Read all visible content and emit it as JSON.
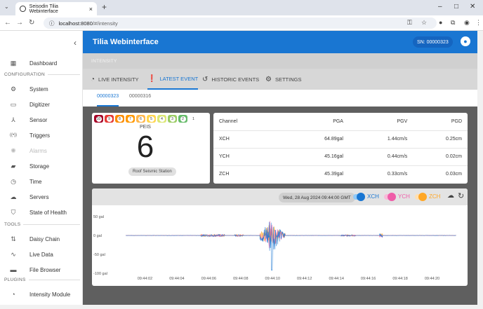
{
  "browser": {
    "tab_title": "Seisodin Tilia Webinterface",
    "url_host": "localhost:8080",
    "url_path": "/#/intensity"
  },
  "sidebar": {
    "items": [
      {
        "label": "Dashboard",
        "icon": "dashboard-icon",
        "glyph": "▦",
        "disabled": false
      },
      {
        "label": "System",
        "icon": "gear-icon",
        "glyph": "⚙",
        "disabled": false
      },
      {
        "label": "Digitizer",
        "icon": "digitizer-icon",
        "glyph": "▭",
        "disabled": false
      },
      {
        "label": "Sensor",
        "icon": "sensor-icon",
        "glyph": "⅄",
        "disabled": false
      },
      {
        "label": "Triggers",
        "icon": "triggers-icon",
        "glyph": "((•))",
        "disabled": false
      },
      {
        "label": "Alarms",
        "icon": "alarm-icon",
        "glyph": "✺",
        "disabled": true
      },
      {
        "label": "Storage",
        "icon": "storage-icon",
        "glyph": "▰",
        "disabled": false
      },
      {
        "label": "Time",
        "icon": "clock-icon",
        "glyph": "◷",
        "disabled": false
      },
      {
        "label": "Servers",
        "icon": "cloud-icon",
        "glyph": "☁",
        "disabled": false
      },
      {
        "label": "State of Health",
        "icon": "shield-icon",
        "glyph": "⛉",
        "disabled": false
      },
      {
        "label": "Daisy Chain",
        "icon": "daisy-chain-icon",
        "glyph": "⇅",
        "disabled": false
      },
      {
        "label": "Live Data",
        "icon": "live-data-icon",
        "glyph": "∿",
        "disabled": false
      },
      {
        "label": "File Browser",
        "icon": "folder-icon",
        "glyph": "▬",
        "disabled": false
      },
      {
        "label": "Intensity Module",
        "icon": "gauge-icon",
        "glyph": "◔",
        "disabled": false
      }
    ],
    "sections": {
      "configuration": "CONFIGURATION",
      "tools": "TOOLS",
      "plugins": "PLUGINS"
    }
  },
  "header": {
    "title": "Tilia Webinterface",
    "serial": "SN: 00000323"
  },
  "breadcrumb": "INTENSITY",
  "tabs": [
    {
      "label": "LIVE INTENSITY",
      "icon": "gauge-icon",
      "active": false
    },
    {
      "label": "LATEST EVENT",
      "icon": "alert-icon",
      "active": true
    },
    {
      "label": "HISTORIC EVENTS",
      "icon": "history-icon",
      "active": false
    },
    {
      "label": "SETTINGS",
      "icon": "gear-icon",
      "active": false
    }
  ],
  "stations": [
    "00000323",
    "00000316"
  ],
  "peis": {
    "scale_levels": [
      "10",
      "9",
      "8",
      "7",
      "6",
      "5",
      "4",
      "3",
      "2",
      "1"
    ],
    "scale_colors": [
      "#a50026",
      "#e53935",
      "#fb8c00",
      "#ff9800",
      "#ffb74d",
      "#ffd54f",
      "#dce775",
      "#9ccc65",
      "#66bb6a",
      "#ffffff"
    ],
    "label": "PEIS",
    "value": "6",
    "station_name": "Roof Seismic Station"
  },
  "table": {
    "headers": [
      "Channel",
      "PGA",
      "PGV",
      "PGD"
    ],
    "rows": [
      [
        "XCH",
        "64.89gal",
        "1.44cm/s",
        "0.25cm"
      ],
      [
        "YCH",
        "45.16gal",
        "0.44cm/s",
        "0.02cm"
      ],
      [
        "ZCH",
        "45.39gal",
        "0.33cm/s",
        "0.03cm"
      ]
    ]
  },
  "chart_toolbar": {
    "timestamp": "Wed, 28 Aug 2024 09:44:00 GMT"
  },
  "chart_data": {
    "type": "line",
    "series": [
      {
        "name": "XCH",
        "color": "#1976d2",
        "visible": true
      },
      {
        "name": "YCH",
        "color": "#ef5da8",
        "visible": true
      },
      {
        "name": "ZCH",
        "color": "#ffa726",
        "visible": true
      }
    ],
    "y_tick_labels": [
      "50 gal",
      "0 gal",
      "-50 gal",
      "-100 gal"
    ],
    "y_ticks": [
      50,
      0,
      -50,
      -100
    ],
    "ylim": [
      -100,
      65
    ],
    "x_tick_labels": [
      "09:44:02",
      "09:44:04",
      "09:44:06",
      "09:44:08",
      "09:44:10",
      "09:44:12",
      "09:44:14",
      "09:44:16",
      "09:44:18",
      "09:44:20"
    ],
    "x_ticks": [
      2,
      4,
      6,
      8,
      10,
      12,
      14,
      16,
      18,
      20
    ],
    "xlim": [
      0,
      22
    ],
    "x_unit": "seconds after 09:44:00",
    "grid": false
  }
}
